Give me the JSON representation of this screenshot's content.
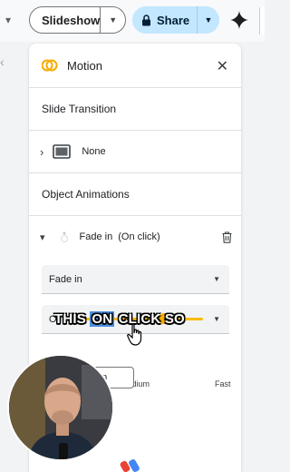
{
  "toolbar": {
    "slideshow_label": "Slideshow",
    "share_label": "Share"
  },
  "panel": {
    "title": "Motion",
    "slide_transition_heading": "Slide Transition",
    "slide_transition_value": "None",
    "object_animations_heading": "Object Animations",
    "animation_item": {
      "name": "Fade in",
      "trigger": "(On click)"
    },
    "effect_select_value": "Fade in",
    "slider": {
      "mid_label": "Medium",
      "right_label": "Fast",
      "level": 0.8
    },
    "play_button_partial": "ction"
  },
  "overlay": {
    "caption_part1": "THIS ",
    "caption_highlight": "ON",
    "caption_part2": " CLICK SO",
    "select_prefix": "O"
  },
  "colors": {
    "share_bg": "#c2e7ff",
    "slider_accent": "#fbbc04",
    "motion_icon": "#f9ab00"
  }
}
